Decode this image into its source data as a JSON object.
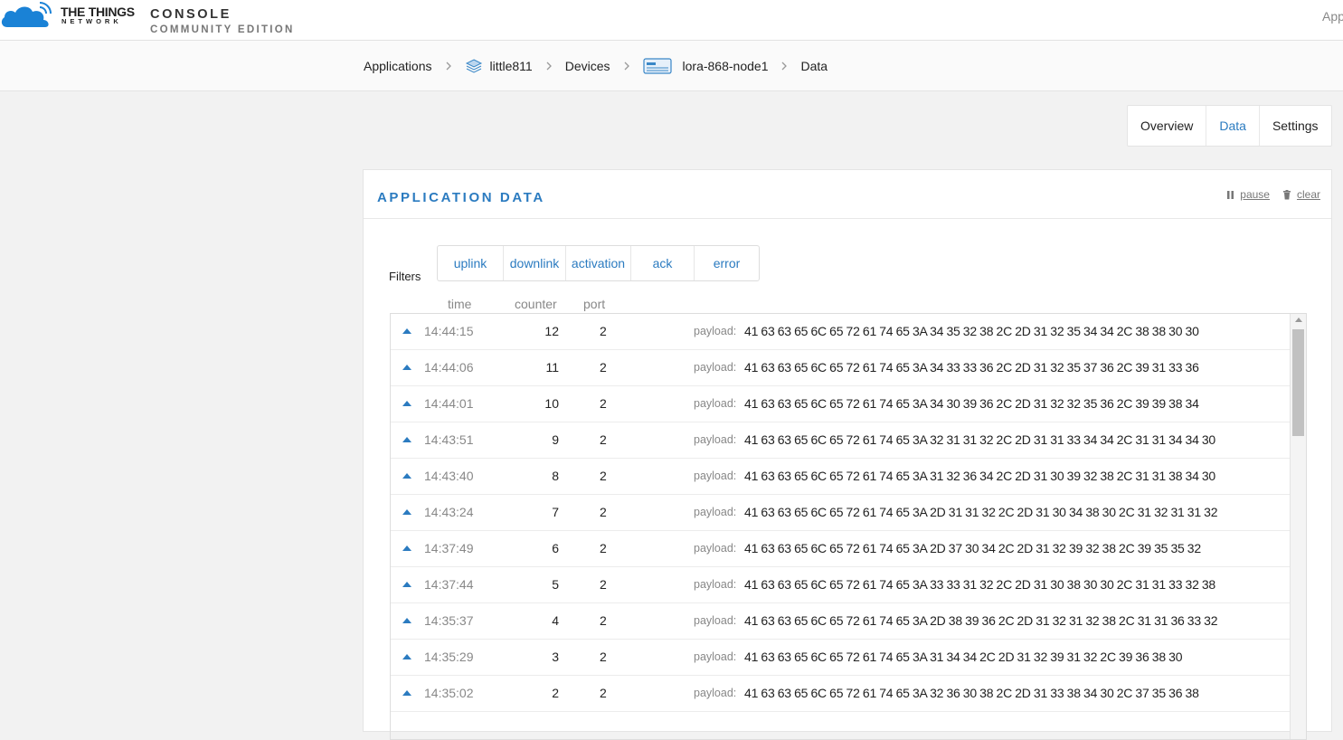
{
  "brand": {
    "line1": "THE THINGS",
    "line2": "NETWORK",
    "console": "CONSOLE",
    "edition": "COMMUNITY EDITION",
    "accent_color": "#2b7bc0",
    "logo_color": "#1a82d6"
  },
  "header": {
    "right_text": "App"
  },
  "breadcrumb": {
    "applications": "Applications",
    "app_name": "little811",
    "devices": "Devices",
    "device_name": "lora-868-node1",
    "current": "Data"
  },
  "tabs": [
    {
      "label": "Overview",
      "active": false
    },
    {
      "label": "Data",
      "active": true
    },
    {
      "label": "Settings",
      "active": false
    }
  ],
  "panel": {
    "title": "APPLICATION DATA",
    "pause_label": "pause",
    "clear_label": "clear"
  },
  "filters": {
    "label": "Filters",
    "items": [
      {
        "label": "uplink"
      },
      {
        "label": "downlink"
      },
      {
        "label": "activation"
      },
      {
        "label": "ack"
      },
      {
        "label": "error"
      }
    ]
  },
  "columns": {
    "time": "time",
    "counter": "counter",
    "port": "port"
  },
  "rows": [
    {
      "time": "14:44:15",
      "counter": "12",
      "port": "2",
      "payload_label": "payload:",
      "payload": "41 63 63 65 6C 65 72 61 74 65 3A 34 35 32 38 2C 2D 31 32 35 34 34 2C 38 38 30 30"
    },
    {
      "time": "14:44:06",
      "counter": "11",
      "port": "2",
      "payload_label": "payload:",
      "payload": "41 63 63 65 6C 65 72 61 74 65 3A 34 33 33 36 2C 2D 31 32 35 37 36 2C 39 31 33 36"
    },
    {
      "time": "14:44:01",
      "counter": "10",
      "port": "2",
      "payload_label": "payload:",
      "payload": "41 63 63 65 6C 65 72 61 74 65 3A 34 30 39 36 2C 2D 31 32 32 35 36 2C 39 39 38 34"
    },
    {
      "time": "14:43:51",
      "counter": "9",
      "port": "2",
      "payload_label": "payload:",
      "payload": "41 63 63 65 6C 65 72 61 74 65 3A 32 31 31 32 2C 2D 31 31 33 34 34 2C 31 31 34 34 30"
    },
    {
      "time": "14:43:40",
      "counter": "8",
      "port": "2",
      "payload_label": "payload:",
      "payload": "41 63 63 65 6C 65 72 61 74 65 3A 31 32 36 34 2C 2D 31 30 39 32 38 2C 31 31 38 34 30"
    },
    {
      "time": "14:43:24",
      "counter": "7",
      "port": "2",
      "payload_label": "payload:",
      "payload": "41 63 63 65 6C 65 72 61 74 65 3A 2D 31 31 32 2C 2D 31 30 34 38 30 2C 31 32 31 31 32"
    },
    {
      "time": "14:37:49",
      "counter": "6",
      "port": "2",
      "payload_label": "payload:",
      "payload": "41 63 63 65 6C 65 72 61 74 65 3A 2D 37 30 34 2C 2D 31 32 39 32 38 2C 39 35 35 32"
    },
    {
      "time": "14:37:44",
      "counter": "5",
      "port": "2",
      "payload_label": "payload:",
      "payload": "41 63 63 65 6C 65 72 61 74 65 3A 33 33 31 32 2C 2D 31 30 38 30 30 2C 31 31 33 32 38"
    },
    {
      "time": "14:35:37",
      "counter": "4",
      "port": "2",
      "payload_label": "payload:",
      "payload": "41 63 63 65 6C 65 72 61 74 65 3A 2D 38 39 36 2C 2D 31 32 31 32 38 2C 31 31 36 33 32"
    },
    {
      "time": "14:35:29",
      "counter": "3",
      "port": "2",
      "payload_label": "payload:",
      "payload": "41 63 63 65 6C 65 72 61 74 65 3A 31 34 34 2C 2D 31 32 39 31 32 2C 39 36 38 30"
    },
    {
      "time": "14:35:02",
      "counter": "2",
      "port": "2",
      "payload_label": "payload:",
      "payload": "41 63 63 65 6C 65 72 61 74 65 3A 32 36 30 38 2C 2D 31 33 38 34 30 2C 37 35 36 38"
    }
  ]
}
